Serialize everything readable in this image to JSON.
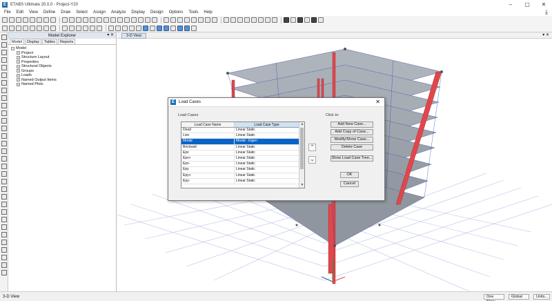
{
  "window": {
    "title": "ETABS Ultimate 20.0.0 - Project-Y20",
    "logo": "E",
    "controls": [
      "–",
      "▢",
      "✕"
    ]
  },
  "menu": [
    "File",
    "Edit",
    "View",
    "Define",
    "Draw",
    "Select",
    "Assign",
    "Analyze",
    "Display",
    "Design",
    "Options",
    "Tools",
    "Help"
  ],
  "explorer": {
    "title": "Model Explorer",
    "controls": "▾ ✕",
    "tabs": [
      "Model",
      "Display",
      "Tables",
      "Reports"
    ],
    "root": "Model",
    "items": [
      "Project",
      "Structure Layout",
      "Properties",
      "Structural Objects",
      "Groups",
      "Loads",
      "Named Output Items",
      "Named Plots"
    ]
  },
  "view": {
    "tab_label": "3-D View",
    "controls": "▾ ✕"
  },
  "status": {
    "left": "3-D View",
    "story": "One Story",
    "coord": "Global",
    "units": "Units..."
  },
  "dialog": {
    "title": "Load Cases",
    "close": "✕",
    "section_label": "Load Cases",
    "click_label": "Click to:",
    "columns": [
      "Load Case Name",
      "Load Case Type"
    ],
    "rows": [
      {
        "name": "Dead",
        "type": "Linear Static"
      },
      {
        "name": "Live",
        "type": "Linear Static"
      },
      {
        "name": "Modal",
        "type": "Modal - Eigen"
      },
      {
        "name": "Brickwall",
        "type": "Linear Static"
      },
      {
        "name": "Epx",
        "type": "Linear Static"
      },
      {
        "name": "Epx+",
        "type": "Linear Static"
      },
      {
        "name": "Epx-",
        "type": "Linear Static"
      },
      {
        "name": "Epy",
        "type": "Linear Static"
      },
      {
        "name": "Epy+",
        "type": "Linear Static"
      },
      {
        "name": "Epy-",
        "type": "Linear Static"
      }
    ],
    "selected_index": 2,
    "buttons": {
      "add_new": "Add New Case...",
      "add_copy": "Add Copy of Case...",
      "modify_show": "Modify/Show Case...",
      "delete": "Delete Case",
      "show_tree": "Show Load Case Tree...",
      "ok": "OK",
      "cancel": "Cancel"
    },
    "move_up": "⌃",
    "move_down": "⌄"
  },
  "colors": {
    "accent": "#0a64c8",
    "column_red": "#e0474c",
    "slab_gray": "#9aa3ad",
    "grid_blue": "#3a4fb0"
  }
}
